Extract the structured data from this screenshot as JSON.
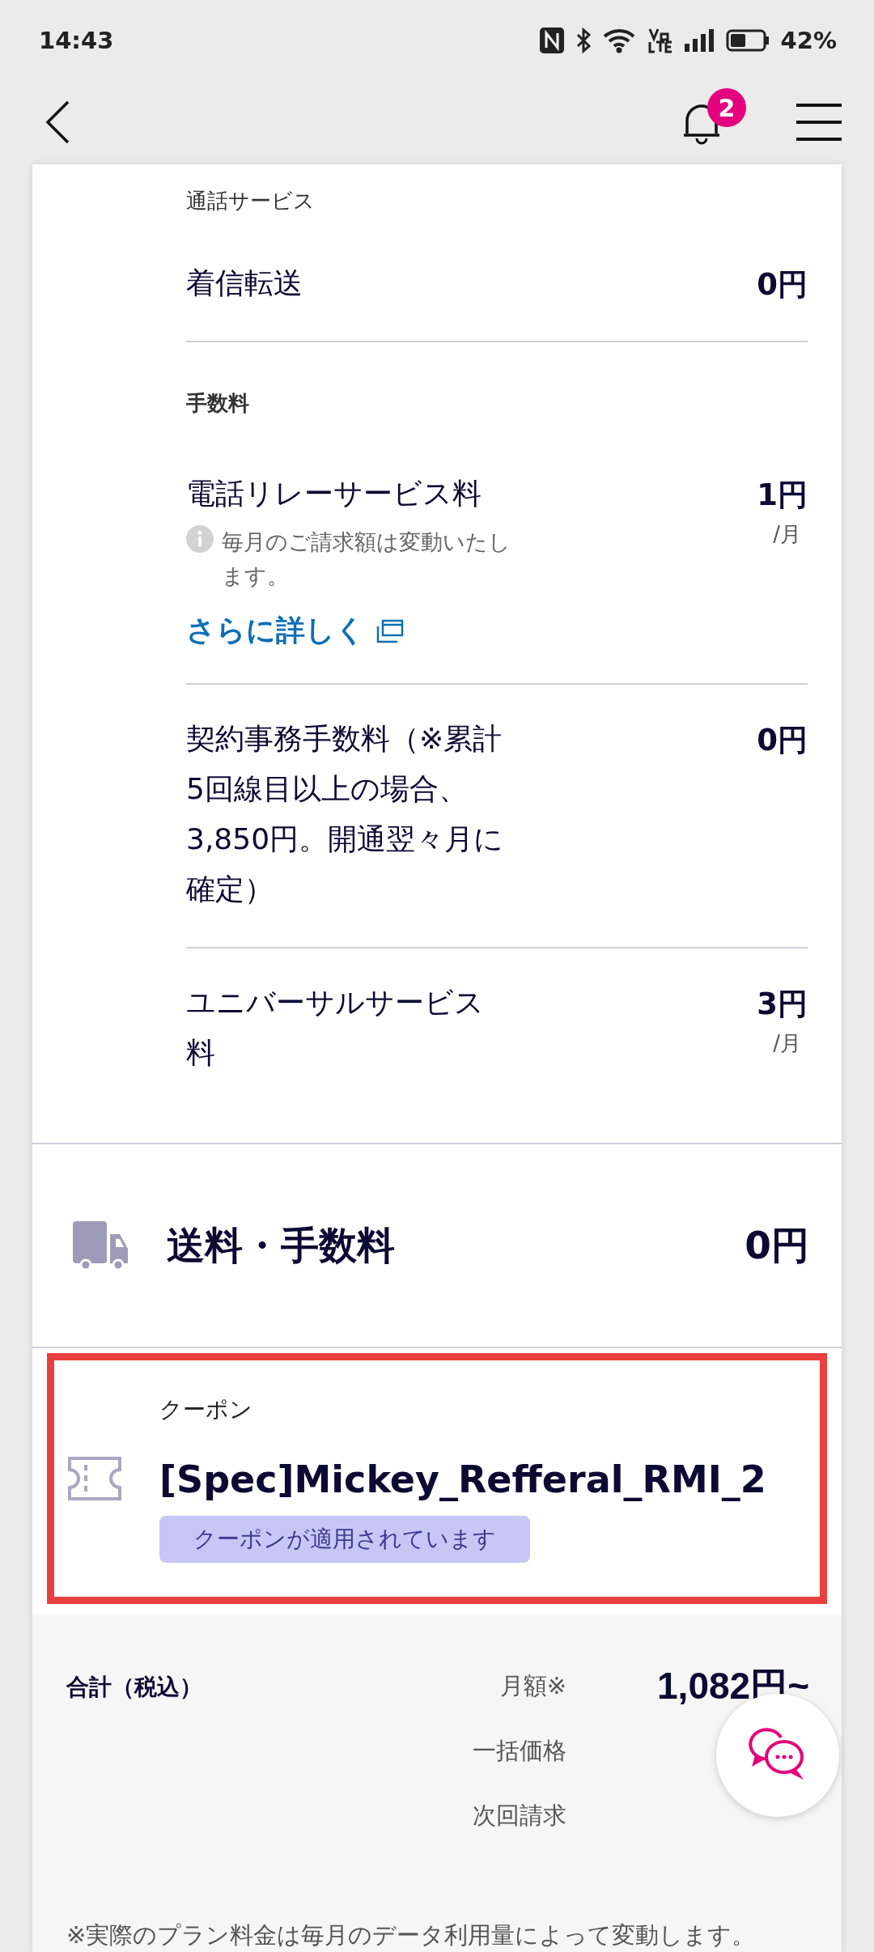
{
  "status_bar": {
    "time": "14:43",
    "battery": "42%"
  },
  "header": {
    "notification_count": "2"
  },
  "sections": [
    {
      "label": "通話サービス",
      "items": [
        {
          "name": "着信転送",
          "amount": "0円"
        }
      ]
    },
    {
      "label": "手数料",
      "items": [
        {
          "name": "電話リレーサービス料",
          "amount": "1円",
          "unit": "/月",
          "note": "毎月のご請求額は変動いたします。",
          "link": "さらに詳しく"
        },
        {
          "name": "契約事務手数料（※累計5回線目以上の場合、3,850円。開通翌々月に確定）",
          "amount": "0円"
        },
        {
          "name": "ユニバーサルサービス料",
          "amount": "3円",
          "unit": "/月"
        }
      ]
    }
  ],
  "shipping": {
    "title": "送料・手数料",
    "amount": "0円"
  },
  "coupon": {
    "label": "クーポン",
    "name": "[Spec]Mickey_Refferal_RMI_2",
    "status": "クーポンが適用されています",
    "highlighted": true
  },
  "totals": {
    "label": "合計（税込）",
    "rows": [
      {
        "label": "月額※",
        "value": "1,082円~"
      },
      {
        "label": "一括価格"
      },
      {
        "label": "次回請求"
      }
    ],
    "footnote": "※実際のプラン料金は毎月のデータ利用量によって変動します。"
  }
}
